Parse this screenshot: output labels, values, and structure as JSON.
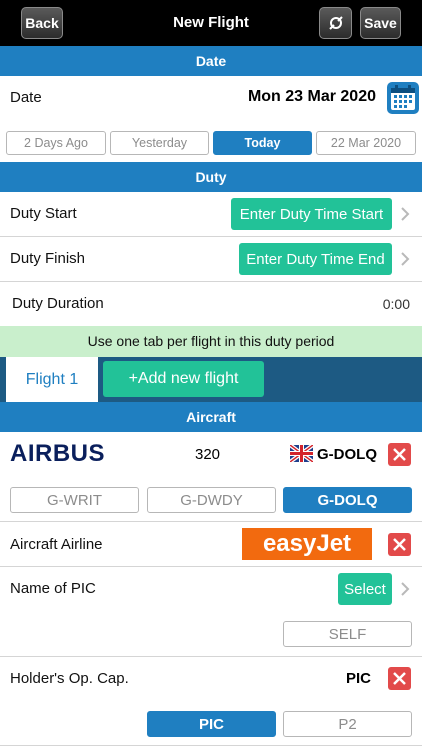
{
  "nav": {
    "back_label": "Back",
    "title": "New Flight",
    "save_label": "Save",
    "settings_icon": "tools-icon"
  },
  "date_section": {
    "header": "Date",
    "label": "Date",
    "value": "Mon 23 Mar 2020",
    "quick": [
      "2 Days Ago",
      "Yesterday",
      "Today",
      "22 Mar 2020"
    ],
    "selected": "Today"
  },
  "duty_section": {
    "header": "Duty",
    "start_label": "Duty Start",
    "start_button": "Enter Duty Time Start",
    "finish_label": "Duty Finish",
    "finish_button": "Enter Duty Time End",
    "duration_label": "Duty Duration",
    "duration_value": "0:00"
  },
  "tab_hint": "Use one tab per flight in this duty period",
  "flight_tabs": {
    "active_tab": "Flight 1",
    "add_button": "+Add new flight"
  },
  "aircraft_section": {
    "header": "Aircraft",
    "manufacturer_logo": "AIRBUS",
    "type": "320",
    "registration": "G-DOLQ",
    "recent_regs": [
      "G-WRIT",
      "G-DWDY",
      "G-DOLQ"
    ],
    "selected_reg": "G-DOLQ",
    "airline_label": "Aircraft Airline",
    "airline_logo": "easyJet",
    "pic_label": "Name of PIC",
    "pic_button": "Select",
    "self_button": "SELF",
    "opcap_label": "Holder's Op. Cap.",
    "opcap_value": "PIC",
    "opcap_options": [
      "PIC",
      "P2"
    ],
    "opcap_selected": "PIC"
  },
  "colors": {
    "accent": "#1f7fc1",
    "green": "#22c298",
    "hint_bg": "#c9efcc",
    "tab_bar": "#1d5a83",
    "delete_red": "#e24a4a",
    "easyjet_orange": "#f26a0f",
    "airbus_navy": "#0a1f5c"
  }
}
